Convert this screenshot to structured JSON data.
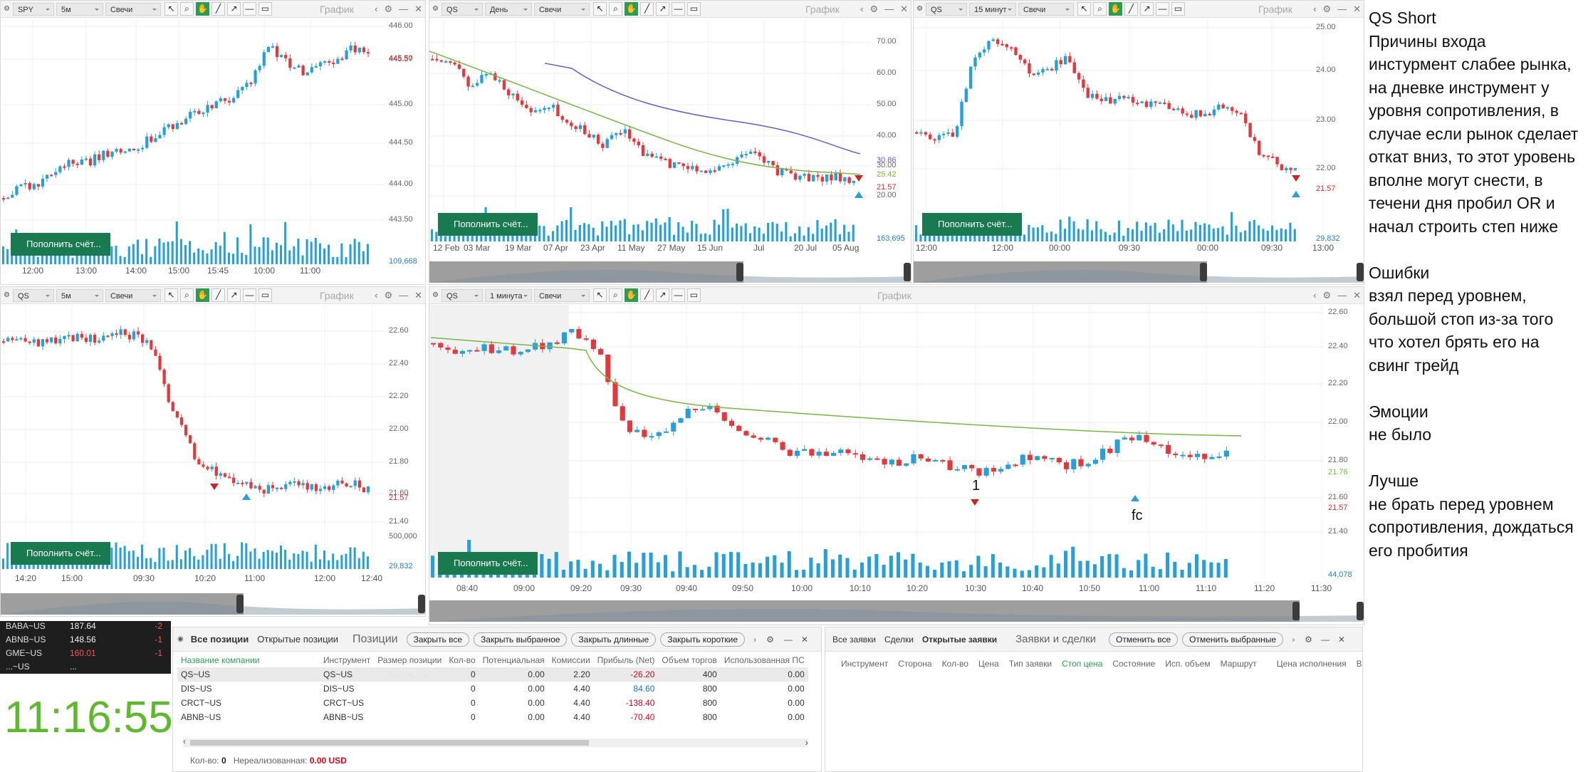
{
  "colors": {
    "up": "#2a9fd6",
    "down": "#e0393e",
    "ma_green": "#77b744",
    "ma_purple": "#6a5acd",
    "accent": "#197a4f",
    "clock": "#5fb82e"
  },
  "common": {
    "chart_title": "График",
    "chart_type": "Свечи",
    "fund_label": "Пополнить счёт...",
    "icons": [
      "gear-icon",
      "arrow-icon",
      "zoom-icon",
      "hand-icon",
      "line-icon",
      "ray-icon",
      "hline-icon",
      "rect-icon",
      "chevron-left-icon",
      "settings-icon",
      "minimize-icon",
      "close-icon"
    ]
  },
  "charts": [
    {
      "id": "spy5",
      "symbol": "SPY",
      "timeframe": "5м",
      "yticks": [
        "446.00",
        "445.50",
        "445.00",
        "444.50",
        "444.00",
        "443.50"
      ],
      "price_label": "445.57",
      "volume_label": "109,668",
      "xticks": [
        "12:00",
        "13:00",
        "14:00",
        "15:00",
        "15:45",
        "10:00",
        "11:00"
      ]
    },
    {
      "id": "qsday",
      "symbol": "QS",
      "timeframe": "День",
      "yticks": [
        "70.00",
        "60.00",
        "50.00",
        "40.00",
        "30.00",
        "20.00"
      ],
      "ma_labels": [
        "30.86",
        "25.42",
        "21.57"
      ],
      "volume_label": "163,695",
      "xticks": [
        "12 Feb",
        "03 Mar",
        "19 Mar",
        "07 Apr",
        "23 Apr",
        "11 May",
        "27 May",
        "15 Jun",
        "Jul",
        "20 Jul",
        "05 Aug"
      ]
    },
    {
      "id": "qs15",
      "symbol": "QS",
      "timeframe": "15 минут",
      "yticks": [
        "25.00",
        "24.00",
        "23.00",
        "22.00"
      ],
      "price_label": "21.57",
      "volume_label": "29,832",
      "xticks": [
        "12:00",
        "12:00",
        "00:00",
        "09:30",
        "00:00",
        "09:30",
        "13:00"
      ]
    },
    {
      "id": "qs5",
      "symbol": "QS",
      "timeframe": "5м",
      "yticks": [
        "22.60",
        "22.40",
        "22.20",
        "22.00",
        "21.80",
        "21.60",
        "21.40"
      ],
      "price_label": "21.57",
      "volume_ticks": [
        "500,000"
      ],
      "volume_label": "29,832",
      "xticks": [
        "14:20",
        "15:00",
        "09:30",
        "10:20",
        "11:00",
        "12:00",
        "12:40"
      ]
    },
    {
      "id": "qs1",
      "symbol": "QS",
      "timeframe": "1 минута",
      "yticks": [
        "22.60",
        "22.40",
        "22.20",
        "22.00",
        "21.80",
        "21.60",
        "21.40"
      ],
      "ma_label": "21.76",
      "price_label": "21.57",
      "volume_label": "44,078",
      "annotations": [
        "1",
        "fc"
      ],
      "xticks": [
        "08:40",
        "09:00",
        "09:20",
        "09:30",
        "09:40",
        "09:50",
        "10:00",
        "10:10",
        "10:20",
        "10:30",
        "10:40",
        "10:50",
        "11:00",
        "11:10",
        "11:20",
        "11:30"
      ]
    }
  ],
  "watchlist": [
    {
      "symbol": "BABA~US",
      "price": "187.64",
      "change": "-2"
    },
    {
      "symbol": "ABNB~US",
      "price": "148.56",
      "change": "-1"
    },
    {
      "symbol": "GME~US",
      "price": "160.01",
      "change": "-1"
    },
    {
      "symbol": "...~US",
      "price": "...",
      "change": ""
    }
  ],
  "clock": "11:16:55",
  "positions": {
    "tabs": [
      "Все позиции",
      "Открытые позиции"
    ],
    "title": "Позиции",
    "buttons": [
      "Закрыть все",
      "Закрыть выбранное",
      "Закрыть длинные",
      "Закрыть короткие"
    ],
    "columns": [
      "Название компании",
      "Инструмент",
      "Размер позиции",
      "Кол-во",
      "Потенциальная",
      "Комиссии",
      "Прибыль (Net)",
      "Объем торгов",
      "Использованная ПС"
    ],
    "rows": [
      [
        "QS~US",
        "QS~US",
        "",
        "0",
        "0.00",
        "2.20",
        "-26.20",
        "400",
        "0.00"
      ],
      [
        "DIS~US",
        "DIS~US",
        "",
        "0",
        "0.00",
        "4.40",
        "84.60",
        "800",
        "0.00"
      ],
      [
        "CRCT~US",
        "CRCT~US",
        "",
        "0",
        "0.00",
        "4.40",
        "-138.40",
        "800",
        "0.00"
      ],
      [
        "ABNB~US",
        "ABNB~US",
        "",
        "0",
        "0.00",
        "4.40",
        "-70.40",
        "800",
        "0.00"
      ]
    ],
    "watermark": "Закрыть",
    "footer_qty_label": "Кол-во:",
    "footer_qty": "0",
    "footer_unreal_label": "Нереализованная:",
    "footer_unreal": "0.00 USD"
  },
  "orders": {
    "tabs": [
      "Все заявки",
      "Сделки",
      "Открытые заявки"
    ],
    "title": "Заявки и сделки",
    "buttons": [
      "Отменить все",
      "Отменить выбранные"
    ],
    "columns": [
      "Инструмент",
      "Сторона",
      "Кол-во",
      "Цена",
      "Тип заявки",
      "Стоп цена",
      "Состояние",
      "Исп. объем",
      "Маршрут",
      "Цена исполнения",
      "Вид"
    ]
  },
  "notes": [
    "QS Short",
    "Причины входа",
    "инстурмент слабее рынка,",
    "на дневке инструмент у",
    "уровня сопротивления, в",
    "случае если рынок сделает",
    "откат вниз, то этот уровень",
    "вполне могут снести, в",
    "течени дня пробил OR и",
    "начал строить степ ниже",
    "",
    "Ошибки",
    "взял перед уровнем,",
    "большой стоп из-за того",
    "что хотел брять его на",
    "свинг трейд",
    "",
    "Эмоции",
    "не было",
    "",
    "Лучше",
    "не брать перед уровнем",
    "сопротивления, дождаться",
    "его пробития"
  ]
}
